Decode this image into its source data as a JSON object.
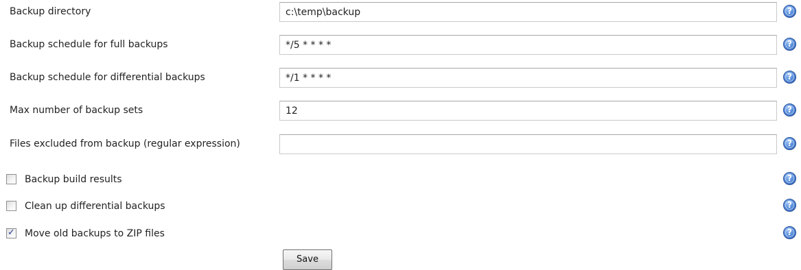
{
  "fields": [
    {
      "label": "Backup directory",
      "value": "c:\\temp\\backup",
      "placeholder": ""
    },
    {
      "label": "Backup schedule for full backups",
      "value": "*/5 * * * *",
      "placeholder": ""
    },
    {
      "label": "Backup schedule for differential backups",
      "value": "*/1 * * * *",
      "placeholder": ""
    },
    {
      "label": "Max number of backup sets",
      "value": "12",
      "placeholder": ""
    },
    {
      "label": "Files excluded from backup (regular expression)",
      "value": "",
      "placeholder": ""
    }
  ],
  "checkboxes": [
    {
      "label": "Backup build results",
      "checked": false
    },
    {
      "label": "Clean up differential backups",
      "checked": false
    },
    {
      "label": "Move old backups to ZIP files",
      "checked": true
    }
  ],
  "help": {
    "glyph": "?",
    "icon": "help-icon"
  },
  "save_button": {
    "label": "Save"
  },
  "colors": {
    "help_icon": "#3a6fc4",
    "checkmark": "#2a3e94",
    "input_border": "#c9c9c9"
  }
}
